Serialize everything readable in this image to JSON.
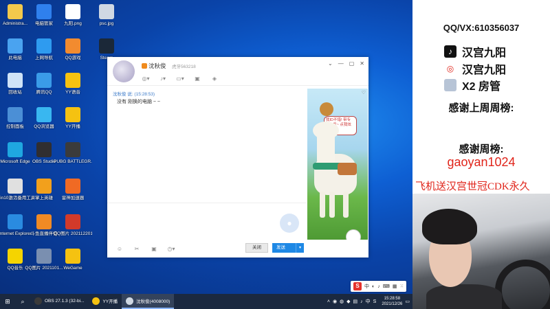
{
  "desktop": {
    "icons": [
      {
        "label": "Administra...",
        "name": "desktop-icon-administrator",
        "color": "#f2c94c"
      },
      {
        "label": "电脑管家",
        "name": "desktop-icon-pc-manager",
        "color": "#2f80ed"
      },
      {
        "label": "九阳.png",
        "name": "desktop-icon-jiuyang-png",
        "color": "#ffffff"
      },
      {
        "label": "psc.jpg",
        "name": "desktop-icon-psc-jpg",
        "color": "#cfd8e3"
      },
      {
        "label": "此电脑",
        "name": "desktop-icon-this-pc",
        "color": "#4aa3f0"
      },
      {
        "label": "上网导航",
        "name": "desktop-icon-web-navigation",
        "color": "#2e9bf0"
      },
      {
        "label": "QQ游戏",
        "name": "desktop-icon-qq-game",
        "color": "#f28b2f"
      },
      {
        "label": "Steam",
        "name": "desktop-icon-steam",
        "color": "#1b2838"
      },
      {
        "label": "回收站",
        "name": "desktop-icon-recycle-bin",
        "color": "#cfe3f7"
      },
      {
        "label": "腾讯QQ",
        "name": "desktop-icon-tencent-qq",
        "color": "#3a9be8"
      },
      {
        "label": "YY语音",
        "name": "desktop-icon-yy-voice",
        "color": "#f5c211"
      },
      {
        "label": "控制面板",
        "name": "desktop-icon-control-panel",
        "color": "#4b8fd6"
      },
      {
        "label": "QQ浏览器",
        "name": "desktop-icon-qq-browser",
        "color": "#39b7f0"
      },
      {
        "label": "YY开播",
        "name": "desktop-icon-yy-live",
        "color": "#f5c211"
      },
      {
        "label": "Microsoft Edge",
        "name": "desktop-icon-edge",
        "color": "#1fa7e0"
      },
      {
        "label": "OBS Studio",
        "name": "desktop-icon-obs",
        "color": "#302e31"
      },
      {
        "label": "PUBG BATTLEGR...",
        "name": "desktop-icon-pubg",
        "color": "#3b3b3b"
      },
      {
        "label": "Win10激活备用工具",
        "name": "desktop-icon-win10-tool",
        "color": "#e0e0e0"
      },
      {
        "label": "掌上英雄",
        "name": "desktop-icon-hero",
        "color": "#f2a01c"
      },
      {
        "label": "雷神加速器",
        "name": "desktop-icon-leishen",
        "color": "#f06a24"
      },
      {
        "label": "Internet Explorer",
        "name": "desktop-icon-ie",
        "color": "#2a8be0"
      },
      {
        "label": "斗鱼直播伴侣",
        "name": "desktop-icon-douyu",
        "color": "#f08a24"
      },
      {
        "label": "QQ图片 202112201...",
        "name": "desktop-icon-qq-image-1",
        "color": "#d23a2a"
      },
      {
        "label": "QQ音乐",
        "name": "desktop-icon-qq-music",
        "color": "#f5d400"
      },
      {
        "label": "QQ图片 2021101...",
        "name": "desktop-icon-qq-image-2",
        "color": "#7a8fb0"
      },
      {
        "label": "WeGame",
        "name": "desktop-icon-wegame",
        "color": "#f5c211"
      }
    ]
  },
  "chat": {
    "contact_name": "沈秋俊",
    "contact_id": "虎牙563218",
    "message_sender_time": "沈秋俊 说: (15:28:53)",
    "message_text": "没有 刚换的电脑 ~ ~",
    "close_label": "关闭",
    "send_label": "发送",
    "ad_bubble_text": "我ID不错! 带专属!! 肯~ 点我炫耀吧!"
  },
  "taskbar": {
    "apps": [
      {
        "label": "OBS 27.1.3 (32-bi...",
        "name": "taskbar-app-obs",
        "color": "#3a3a3a",
        "active": false
      },
      {
        "label": "YY开播",
        "name": "taskbar-app-yy",
        "color": "#f5c211",
        "active": false
      },
      {
        "label": "沈秋俊(4008000)",
        "name": "taskbar-app-qq-chat",
        "color": "#cfd8e3",
        "active": true
      }
    ],
    "time": "15:28:58",
    "date": "2021/12/26",
    "ime_lang": "中"
  },
  "overlay": {
    "contact": "QQ/VX:610356037",
    "socials": [
      {
        "icon": "tiktok-icon",
        "label": "汉宫九阳"
      },
      {
        "icon": "weibo-icon",
        "label": "汉宫九阳"
      },
      {
        "icon": "avatar-icon",
        "label": "X2 房管"
      }
    ],
    "last_week_title": "感谢上周周榜:",
    "week_title": "感谢周榜:",
    "week_top": "gaoyan1024",
    "scroll_text": "飞机送汉宫世冠CDK永久"
  }
}
